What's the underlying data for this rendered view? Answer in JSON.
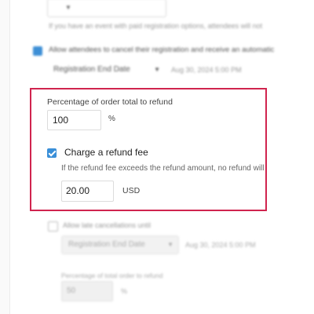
{
  "background": {
    "top_help": "If you have an event with paid registration options, attendees will not",
    "allow_cancel_label": "Allow attendees to cancel their registration and receive an automatic",
    "allow_cancel_checked": true,
    "reg_select_1": "Registration End Date",
    "reg_date_1": "Aug 30, 2024 5:00 PM"
  },
  "highlight": {
    "pct_label": "Percentage of order total to refund",
    "pct_value": "100",
    "pct_sign": "%",
    "fee_checked": true,
    "fee_label": "Charge a refund fee",
    "fee_help": "If the refund fee exceeds the refund amount, no refund will be iss",
    "fee_value": "20.00",
    "fee_currency": "USD"
  },
  "lower": {
    "late_label": "Allow late cancellations until",
    "late_checked": false,
    "reg_select_2": "Registration End Date",
    "reg_date_2": "Aug 30, 2024 5:00 PM",
    "pct2_label": "Percentage of total order to refund",
    "pct2_value": "50",
    "pct2_sign": "%"
  },
  "colors": {
    "highlight_border": "#d0244e",
    "checkbox_blue": "#3a8fd8"
  }
}
